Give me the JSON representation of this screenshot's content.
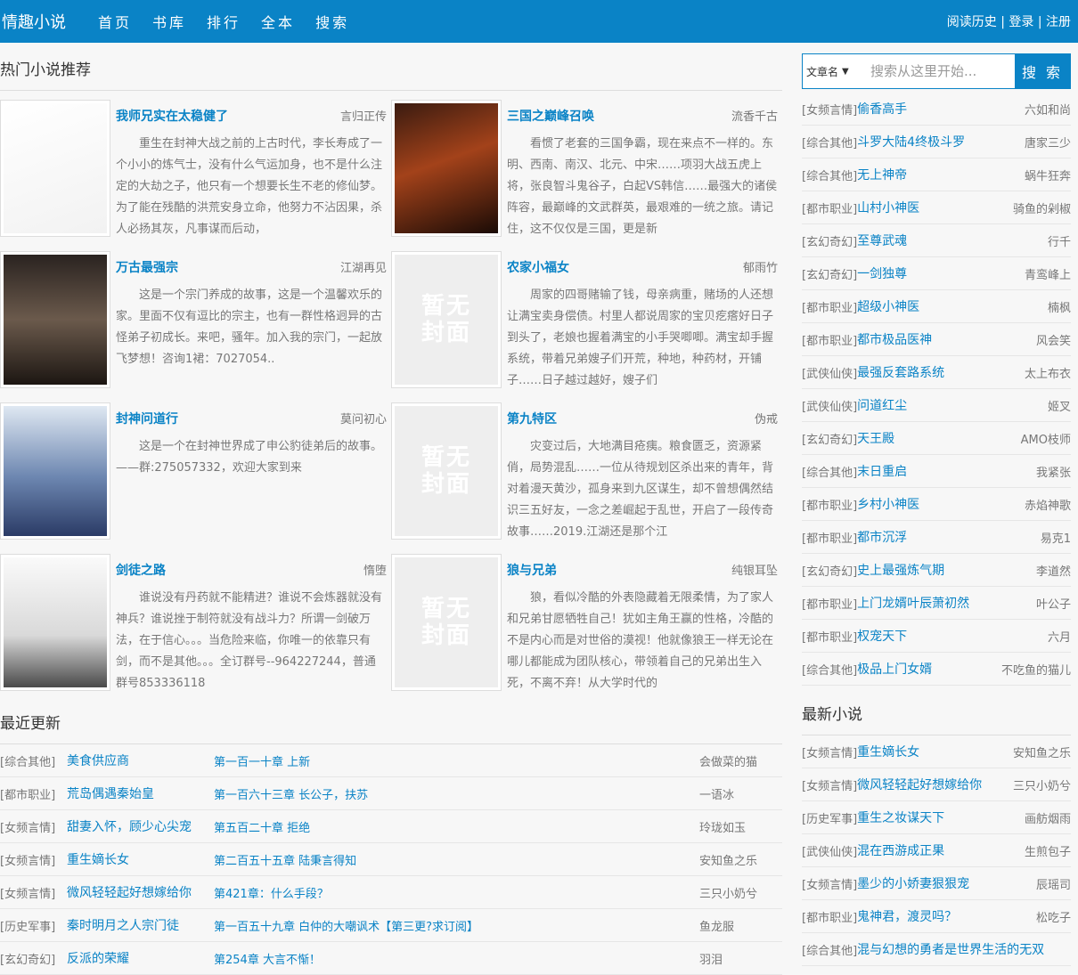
{
  "header": {
    "logo": "情趣小说",
    "nav": [
      "首页",
      "书库",
      "排行",
      "全本",
      "搜索"
    ],
    "history": "阅读历史",
    "login": "登录",
    "register": "注册",
    "sep": "|"
  },
  "hot": {
    "title": "热门小说推荐",
    "books": [
      {
        "title": "我师兄实在太稳健了",
        "author": "言归正传",
        "desc": "重生在封神大战之前的上古时代，李长寿成了一个小小的炼气士，没有什么气运加身，也不是什么注定的大劫之子，他只有一个想要长生不老的修仙梦。为了能在残酷的洪荒安身立命，他努力不沾因果，杀人必扬其灰，凡事谋而后动，",
        "cover": "image"
      },
      {
        "title": "三国之巅峰召唤",
        "author": "流香千古",
        "desc": "看惯了老套的三国争霸，现在来点不一样的。东明、西南、南汉、北元、中宋……项羽大战五虎上将，张良智斗鬼谷子，白起VS韩信……最强大的诸侯阵容，最巅峰的文武群英，最艰难的一统之旅。请记住，这不仅仅是三国，更是新",
        "cover": "image"
      },
      {
        "title": "万古最强宗",
        "author": "江湖再见",
        "desc": "这是一个宗门养成的故事，这是一个温馨欢乐的家。里面不仅有逗比的宗主，也有一群性格迥异的古怪弟子初成长。来吧，骚年。加入我的宗门，一起放飞梦想！咨询1裙：7027054..",
        "cover": "image"
      },
      {
        "title": "农家小福女",
        "author": "郁雨竹",
        "desc": "周家的四哥赌输了钱，母亲病重，赌场的人还想让满宝卖身偿债。村里人都说周家的宝贝疙瘩好日子到头了，老娘也握着满宝的小手哭唧唧。满宝却手握系统，带着兄弟嫂子们开荒，种地，种药材，开铺子……日子越过越好，嫂子们",
        "cover": "placeholder"
      },
      {
        "title": "封神问道行",
        "author": "莫问初心",
        "desc": "这是一个在封神世界成了申公豹徒弟后的故事。——群:275057332，欢迎大家到来",
        "cover": "image"
      },
      {
        "title": "第九特区",
        "author": "伪戒",
        "desc": "灾变过后，大地满目疮痍。粮食匮乏，资源紧俏，局势混乱……一位从待规划区杀出来的青年，背对着漫天黄沙，孤身来到九区谋生，却不曾想偶然结识三五好友，一念之差崛起于乱世，开启了一段传奇故事……2019.江湖还是那个江",
        "cover": "placeholder"
      },
      {
        "title": "剑徒之路",
        "author": "惰堕",
        "desc": "谁说没有丹药就不能精进？谁说不会炼器就没有神兵？谁说挫于制符就没有战斗力？所谓一剑破万法，在于信心。。。当危险来临，你唯一的依靠只有剑，而不是其他。。。全订群号--964227244，普通群号853336118",
        "cover": "image"
      },
      {
        "title": "狼与兄弟",
        "author": "纯银耳坠",
        "desc": "狼，看似冷酷的外表隐藏着无限柔情，为了家人和兄弟甘愿牺牲自己！犹如主角王赢的性格，冷酷的不是内心而是对世俗的漠视！他就像狼王一样无论在哪儿都能成为团队核心，带领着自己的兄弟出生入死，不离不弃！从大学时代的",
        "cover": "placeholder"
      }
    ],
    "placeholder_text": "暂无封面"
  },
  "search": {
    "select_value": "文章名",
    "placeholder": "搜索从这里开始...",
    "button": "搜 索"
  },
  "ranking": [
    {
      "cat": "[女频言情]",
      "name": "偷香高手",
      "author": "六如和尚"
    },
    {
      "cat": "[综合其他]",
      "name": "斗罗大陆4终极斗罗",
      "author": "唐家三少"
    },
    {
      "cat": "[综合其他]",
      "name": "无上神帝",
      "author": "蜗牛狂奔"
    },
    {
      "cat": "[都市职业]",
      "name": "山村小神医",
      "author": "骑鱼的剁椒"
    },
    {
      "cat": "[玄幻奇幻]",
      "name": "至尊武魂",
      "author": "行千"
    },
    {
      "cat": "[玄幻奇幻]",
      "name": "一剑独尊",
      "author": "青鸾峰上"
    },
    {
      "cat": "[都市职业]",
      "name": "超级小神医",
      "author": "楠枫"
    },
    {
      "cat": "[都市职业]",
      "name": "都市极品医神",
      "author": "风会笑"
    },
    {
      "cat": "[武侠仙侠]",
      "name": "最强反套路系统",
      "author": "太上布衣"
    },
    {
      "cat": "[武侠仙侠]",
      "name": "问道红尘",
      "author": "姬叉"
    },
    {
      "cat": "[玄幻奇幻]",
      "name": "天王殿",
      "author": "AMO枝师"
    },
    {
      "cat": "[综合其他]",
      "name": "末日重启",
      "author": "我紧张"
    },
    {
      "cat": "[都市职业]",
      "name": "乡村小神医",
      "author": "赤焰神歌"
    },
    {
      "cat": "[都市职业]",
      "name": "都市沉浮",
      "author": "易克1"
    },
    {
      "cat": "[玄幻奇幻]",
      "name": "史上最强炼气期",
      "author": "李道然"
    },
    {
      "cat": "[都市职业]",
      "name": "上门龙婿叶辰萧初然",
      "author": "叶公子"
    },
    {
      "cat": "[都市职业]",
      "name": "权宠天下",
      "author": "六月"
    },
    {
      "cat": "[综合其他]",
      "name": "极品上门女婿",
      "author": "不吃鱼的猫儿"
    }
  ],
  "recent": {
    "title": "最近更新",
    "rows": [
      {
        "cat": "[综合其他]",
        "name": "美食供应商",
        "chapter": "第一百一十章 上新",
        "author": "会做菜的猫"
      },
      {
        "cat": "[都市职业]",
        "name": "荒岛偶遇秦始皇",
        "chapter": "第一百六十三章 长公子，扶苏",
        "author": "一语冰"
      },
      {
        "cat": "[女频言情]",
        "name": "甜妻入怀，顾少心尖宠",
        "chapter": "第五百二十章 拒绝",
        "author": "玲珑如玉"
      },
      {
        "cat": "[女频言情]",
        "name": "重生嫡长女",
        "chapter": "第二百五十五章 陆秉言得知",
        "author": "安知鱼之乐"
      },
      {
        "cat": "[女频言情]",
        "name": "微风轻轻起好想嫁给你",
        "chapter": "第421章：什么手段？",
        "author": "三只小奶兮"
      },
      {
        "cat": "[历史军事]",
        "name": "秦时明月之人宗门徒",
        "chapter": "第一百五十九章 白仲的大嘲讽术【第三更?求订阅】",
        "author": "鱼龙服"
      },
      {
        "cat": "[玄幻奇幻]",
        "name": "反派的荣耀",
        "chapter": "第254章 大言不惭！",
        "author": "羽泪"
      }
    ]
  },
  "newest": {
    "title": "最新小说",
    "rows": [
      {
        "cat": "[女频言情]",
        "name": "重生嫡长女",
        "author": "安知鱼之乐"
      },
      {
        "cat": "[女频言情]",
        "name": "微风轻轻起好想嫁给你",
        "author": "三只小奶兮"
      },
      {
        "cat": "[历史军事]",
        "name": "重生之妆谋天下",
        "author": "画舫烟雨"
      },
      {
        "cat": "[武侠仙侠]",
        "name": "混在西游成正果",
        "author": "生煎包子"
      },
      {
        "cat": "[女频言情]",
        "name": "墨少的小娇妻狠狠宠",
        "author": "辰瑶司"
      },
      {
        "cat": "[都市职业]",
        "name": "鬼神君，渡灵吗？",
        "author": "松吃子"
      },
      {
        "cat": "[综合其他]",
        "name": "混与幻想的勇者是世界生活的无双",
        "author": ""
      }
    ]
  }
}
